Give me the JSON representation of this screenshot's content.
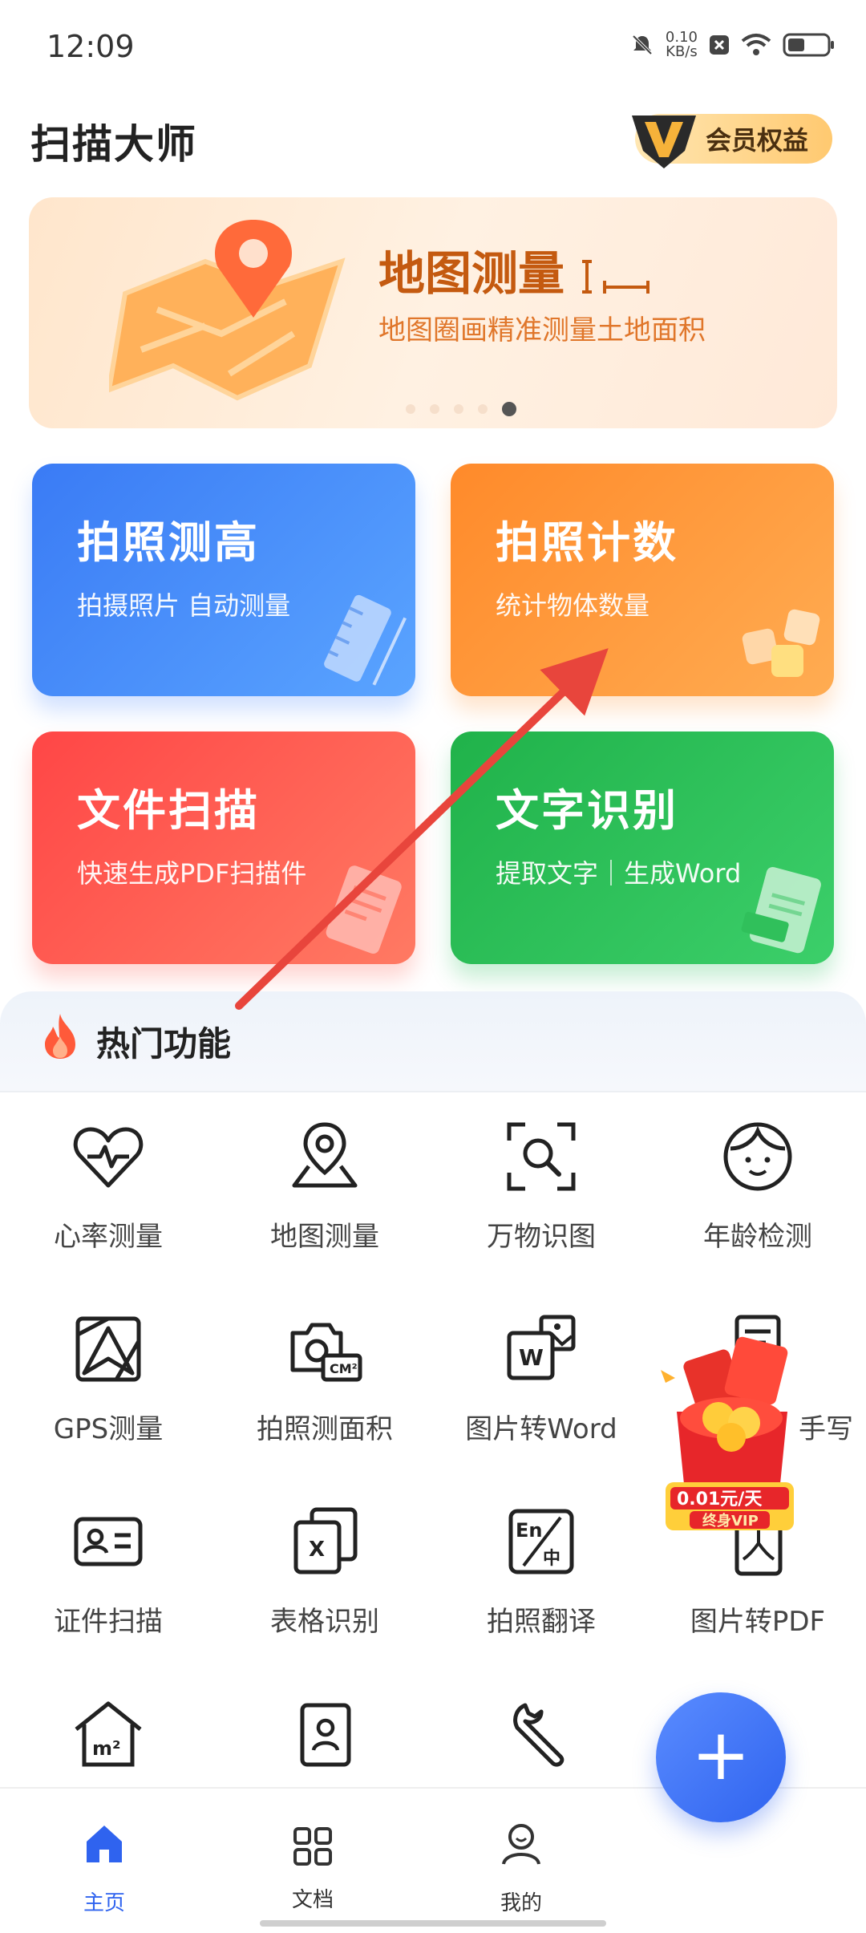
{
  "status_bar": {
    "time": "12:09",
    "net_speed_value": "0.10",
    "net_speed_unit": "KB/s"
  },
  "header": {
    "app_title": "扫描大师",
    "vip_label": "会员权益"
  },
  "banner": {
    "title": "地图测量",
    "subtitle": "地图圈画精准测量土地面积",
    "page_count": 5,
    "active_page": 5
  },
  "feature_cards": [
    {
      "title": "拍照测高",
      "subtitle": "拍摄照片 自动测量",
      "color": "#3a7bf5"
    },
    {
      "title": "拍照计数",
      "subtitle": "统计物体数量",
      "color": "#ff8a2a"
    },
    {
      "title": "文件扫描",
      "subtitle": "快速生成PDF扫描件",
      "color": "#ff4646"
    },
    {
      "title": "文字识别",
      "subtitle": "提取文字｜生成Word",
      "color": "#20b24a"
    }
  ],
  "hot_section": {
    "title": "热门功能",
    "items": [
      {
        "label": "心率测量",
        "icon": "heart-rate-icon"
      },
      {
        "label": "地图测量",
        "icon": "map-pin-icon"
      },
      {
        "label": "万物识图",
        "icon": "image-search-icon"
      },
      {
        "label": "年龄检测",
        "icon": "face-icon"
      },
      {
        "label": "GPS测量",
        "icon": "gps-map-icon"
      },
      {
        "label": "拍照测面积",
        "icon": "camera-area-icon"
      },
      {
        "label": "图片转Word",
        "icon": "image-to-word-icon"
      },
      {
        "label": "手写",
        "icon": "handwriting-icon"
      },
      {
        "label": "证件扫描",
        "icon": "id-card-icon"
      },
      {
        "label": "表格识别",
        "icon": "table-recognize-icon"
      },
      {
        "label": "拍照翻译",
        "icon": "translate-icon"
      },
      {
        "label": "图片转PDF",
        "icon": "image-to-pdf-icon"
      },
      {
        "label": "",
        "icon": "house-area-icon"
      },
      {
        "label": "",
        "icon": "contact-book-icon"
      },
      {
        "label": "",
        "icon": "wrench-icon"
      }
    ]
  },
  "promo": {
    "price_text": "0.01元/天",
    "vip_text": "终身VIP"
  },
  "fab": {
    "label": "+"
  },
  "bottom_nav": [
    {
      "label": "主页",
      "icon": "home-icon",
      "active": true
    },
    {
      "label": "文档",
      "icon": "documents-icon",
      "active": false
    },
    {
      "label": "我的",
      "icon": "profile-icon",
      "active": false
    }
  ]
}
